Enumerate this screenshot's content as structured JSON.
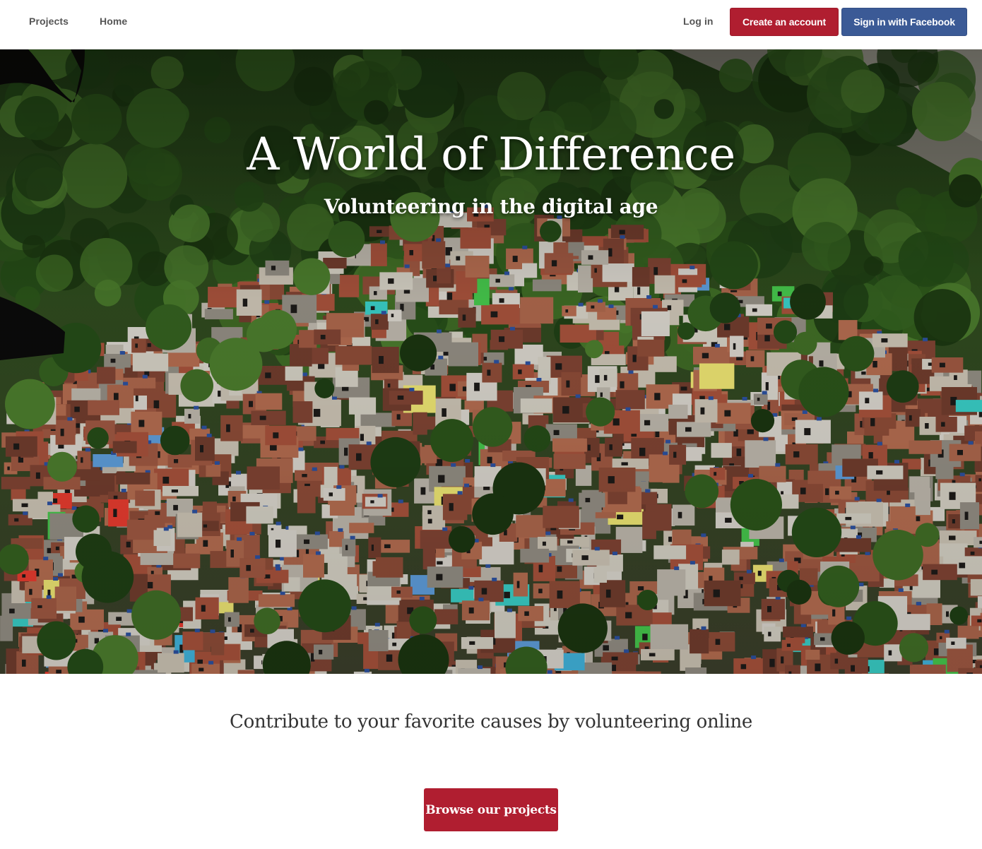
{
  "nav": {
    "projects_label": "Projects",
    "home_label": "Home",
    "login_label": "Log in",
    "create_account_label": "Create an account",
    "facebook_label": "Sign in with Facebook"
  },
  "hero": {
    "title": "A World of Difference",
    "subtitle": "Volunteering in the digital age"
  },
  "main": {
    "tagline": "Contribute to your favorite causes by volunteering online",
    "browse_label": "Browse our projects"
  },
  "colors": {
    "primary_red": "#b01e30",
    "facebook_blue": "#3b5a96"
  }
}
